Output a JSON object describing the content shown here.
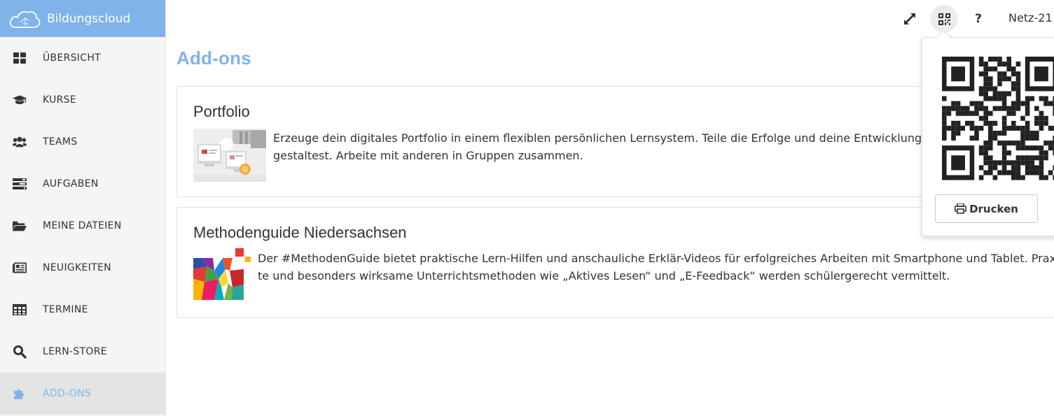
{
  "brand": {
    "name": "Bildungscloud",
    "icon": "cloud-logo-icon",
    "color": "#80b3e9"
  },
  "sidebar": {
    "items": [
      {
        "label": "ÜBERSICHT",
        "icon": "dashboard-icon"
      },
      {
        "label": "KURSE",
        "icon": "graduation-cap-icon"
      },
      {
        "label": "TEAMS",
        "icon": "users-icon"
      },
      {
        "label": "AUFGABEN",
        "icon": "tasks-icon"
      },
      {
        "label": "MEINE DATEIEN",
        "icon": "folder-open-icon"
      },
      {
        "label": "NEUIGKEITEN",
        "icon": "newspaper-icon"
      },
      {
        "label": "TERMINE",
        "icon": "calendar-table-icon"
      },
      {
        "label": "LERN-STORE",
        "icon": "search-icon"
      },
      {
        "label": "ADD-ONS",
        "icon": "puzzle-icon",
        "active": true
      }
    ]
  },
  "topbar": {
    "fullscreen_icon": "expand-icon",
    "qr_icon": "qrcode-icon",
    "help_label": "?",
    "school": "Netz-21"
  },
  "main": {
    "title": "Add-ons",
    "addons": [
      {
        "title": "Portfolio",
        "thumbnail_icon": "portfolio-illustration",
        "desc_line1": "Erzeuge dein digitales Portfolio in einem flexiblen persönlichen Lernsystem. Teile die Erfolge und deine Entwicklung an e",
        "desc_line2": "gestaltest. Arbeite mit anderen in Gruppen zusammen."
      },
      {
        "title": "Methodenguide Niedersachsen",
        "thumbnail_icon": "methodenguide-logo",
        "desc_line1": "Der #MethodenGuide bietet praktische Lern-Hilfen und anschauliche Erklär-Videos für erfolgreiches Arbeiten mit Smartphone und Tablet. Praxiserpro",
        "desc_line2": "te und besonders wirksame Unterrichtsmethoden wie „Aktives Lesen“ und „E-Feedback“ werden schülergerecht vermittelt."
      }
    ]
  },
  "qr_popover": {
    "print_label": "Drucken",
    "print_icon": "printer-icon"
  }
}
